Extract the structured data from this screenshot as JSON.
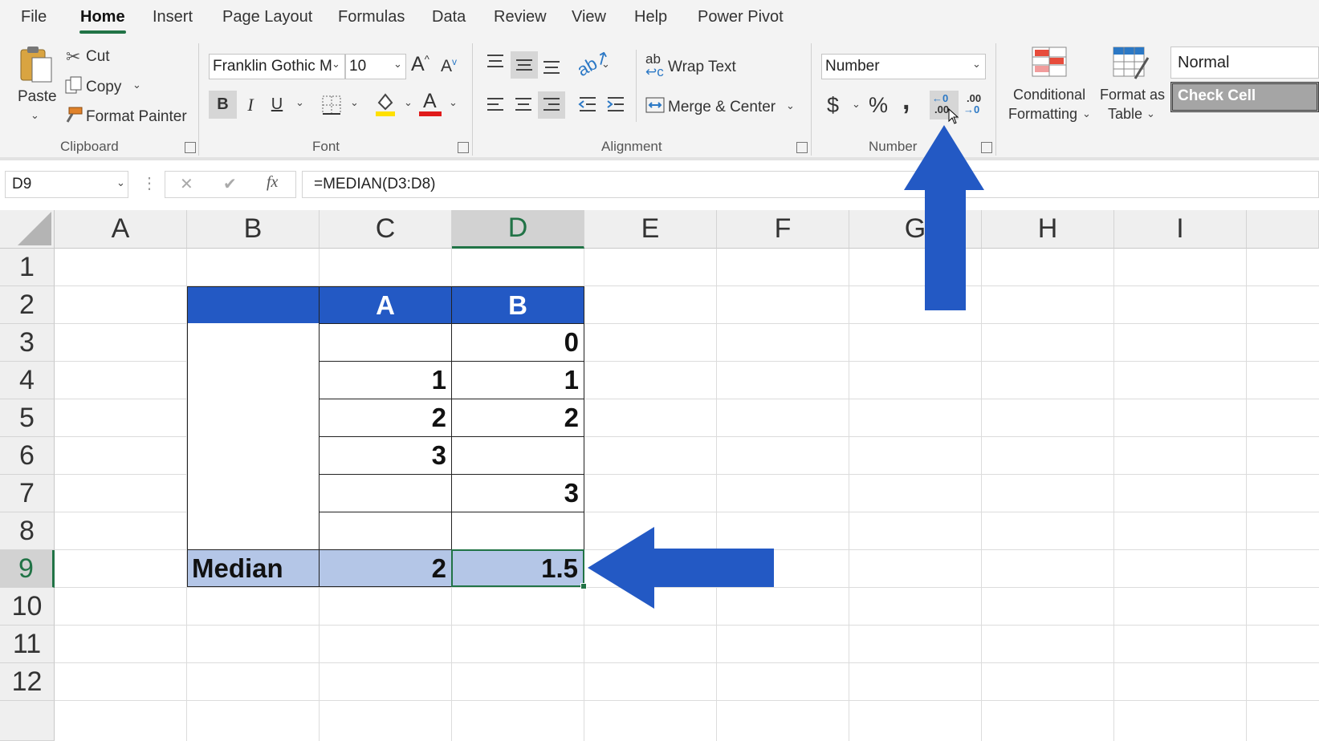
{
  "ribbon": {
    "tabs": [
      "File",
      "Home",
      "Insert",
      "Page Layout",
      "Formulas",
      "Data",
      "Review",
      "View",
      "Help",
      "Power Pivot"
    ],
    "clipboard": {
      "paste": "Paste",
      "cut": "Cut",
      "copy": "Copy",
      "format_painter": "Format Painter",
      "label": "Clipboard"
    },
    "font": {
      "name": "Franklin Gothic M",
      "size": "10",
      "label": "Font",
      "bold": "B",
      "italic": "I",
      "underline": "U",
      "grow": "A",
      "shrink": "A",
      "color_letter": "A"
    },
    "alignment": {
      "wrap_text": "Wrap Text",
      "merge_center": "Merge & Center",
      "label": "Alignment"
    },
    "number": {
      "format": "Number",
      "currency": "$",
      "percent": "%",
      "comma": ",",
      "label": "Number",
      "increase_decimal": ".00",
      "decrease_decimal": ".00"
    },
    "styles": {
      "conditional_line1": "Conditional",
      "conditional_line2": "Formatting",
      "table_line1": "Format as",
      "table_line2": "Table",
      "normal": "Normal",
      "check_cell": "Check Cell"
    }
  },
  "formula_bar": {
    "name_box": "D9",
    "cancel": "✕",
    "enter": "✔",
    "fx": "fx",
    "formula": "=MEDIAN(D3:D8)"
  },
  "columns": [
    "A",
    "B",
    "C",
    "D",
    "E",
    "F",
    "G",
    "H",
    "I"
  ],
  "rows": [
    "1",
    "2",
    "3",
    "4",
    "5",
    "6",
    "7",
    "8",
    "9",
    "10",
    "11",
    "12"
  ],
  "selected_cell": "D9",
  "table": {
    "header": {
      "c": "A",
      "d": "B"
    },
    "c_values": {
      "r4": "1",
      "r5": "2",
      "r6": "3"
    },
    "d_values": {
      "r3": "0",
      "r4": "1",
      "r5": "2",
      "r7": "3"
    },
    "median_label": "Median",
    "median_c": "2",
    "median_d": "1.5"
  },
  "colors": {
    "header_fill": "#2359c4",
    "median_fill": "#b4c6e7",
    "arrow": "#2359c4",
    "excel_green": "#217346"
  },
  "annotations": {
    "up_arrow_target": "increase-decimal-button",
    "left_arrow_target": "cell-d9"
  }
}
